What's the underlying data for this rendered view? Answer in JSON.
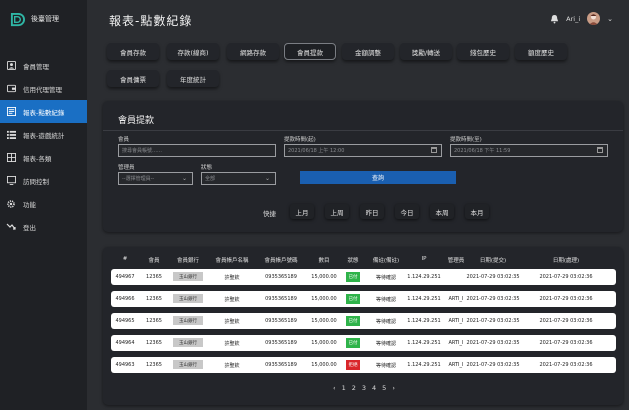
{
  "sidebar": {
    "brand": "後臺管理",
    "items": [
      {
        "label": "會員管理",
        "icon": "person-icon",
        "active": false
      },
      {
        "label": "信用代理管理",
        "icon": "wallet-icon",
        "active": false
      },
      {
        "label": "報表-點數紀錄",
        "icon": "report-icon",
        "active": true
      },
      {
        "label": "報表-遊戲統計",
        "icon": "list-icon",
        "active": false
      },
      {
        "label": "報表-各類",
        "icon": "grid-icon",
        "active": false
      },
      {
        "label": "訪問控制",
        "icon": "monitor-icon",
        "active": false
      },
      {
        "label": "功能",
        "icon": "gear-icon",
        "active": false
      },
      {
        "label": "登出",
        "icon": "logout-icon",
        "active": false
      }
    ]
  },
  "header": {
    "title": "報表-點數紀錄",
    "username": "Ari_i"
  },
  "tabs": [
    {
      "label": "會員存款",
      "active": false
    },
    {
      "label": "存款(線商)",
      "active": false
    },
    {
      "label": "網路存款",
      "active": false
    },
    {
      "label": "會員提款",
      "active": true
    },
    {
      "label": "金額調整",
      "active": false
    },
    {
      "label": "獎勵/轉送",
      "active": false
    },
    {
      "label": "錢包歷史",
      "active": false
    },
    {
      "label": "額度歷史",
      "active": false
    },
    {
      "label": "會員傭票",
      "active": false
    },
    {
      "label": "年度統計",
      "active": false
    }
  ],
  "filter": {
    "title": "會員提款",
    "member_label": "會員",
    "member_placeholder": "搜尋會員帳號……",
    "start_label": "提款時間(起)",
    "start_value": "2021/06/18 上午 12:00",
    "end_label": "提款時間(至)",
    "end_value": "2021/06/18 下午 11:59",
    "manager_label": "管理員",
    "manager_value": "--選擇管理員--",
    "status_label": "狀態",
    "status_value": "全部",
    "query_button": "查詢",
    "quick_label": "快捷",
    "quick_buttons": [
      "上月",
      "上周",
      "昨日",
      "今日",
      "本周",
      "本月"
    ]
  },
  "table": {
    "columns": [
      "#",
      "會員",
      "會員銀行",
      "會員帳戶名稱",
      "會員帳戶號碼",
      "數目",
      "狀態",
      "備註(備註)",
      "IP",
      "管理員",
      "日期(提交)",
      "日期(處理)"
    ],
    "rows": [
      {
        "id": "494967",
        "member": "12365",
        "bank": "玉山銀行",
        "acct_name": "許聖欽",
        "acct_no": "0935365189",
        "amount": "15,000.00",
        "status": "已付",
        "status_color": "#2fb34a",
        "note": "等待確認",
        "ip": "1.124.29.251",
        "admin": "",
        "submit": "2021-07-29 03:02:35",
        "process": "2021-07-29 03:02:36"
      },
      {
        "id": "494966",
        "member": "12365",
        "bank": "玉山銀行",
        "acct_name": "許聖欽",
        "acct_no": "0935365189",
        "amount": "15,000.00",
        "status": "已付",
        "status_color": "#2fb34a",
        "note": "等待確認",
        "ip": "1.124.29.251",
        "admin": "ARTI_I",
        "submit": "2021-07-29 03:02:35",
        "process": "2021-07-29 03:02:36"
      },
      {
        "id": "494965",
        "member": "12365",
        "bank": "玉山銀行",
        "acct_name": "許聖欽",
        "acct_no": "0935365189",
        "amount": "15,000.00",
        "status": "已付",
        "status_color": "#2fb34a",
        "note": "等待確認",
        "ip": "1.124.29.251",
        "admin": "ARTI_I",
        "submit": "2021-07-29 03:02:35",
        "process": "2021-07-29 03:02:36"
      },
      {
        "id": "494964",
        "member": "12365",
        "bank": "玉山銀行",
        "acct_name": "許聖欽",
        "acct_no": "0935365189",
        "amount": "15,000.00",
        "status": "已付",
        "status_color": "#2fb34a",
        "note": "等待確認",
        "ip": "1.124.29.251",
        "admin": "ARTI_I",
        "submit": "2021-07-29 03:02:35",
        "process": "2021-07-29 03:02:36"
      },
      {
        "id": "494963",
        "member": "12365",
        "bank": "玉山銀行",
        "acct_name": "許聖欽",
        "acct_no": "0935365189",
        "amount": "15,000.00",
        "status": "拒絕",
        "status_color": "#d9262b",
        "note": "等待確認",
        "ip": "1.124.29.251",
        "admin": "ARTI_I",
        "submit": "2021-07-29 03:02:35",
        "process": "2021-07-29 03:02:36"
      }
    ]
  },
  "pager": {
    "prev": "‹",
    "pages": [
      "1",
      "2",
      "3",
      "4",
      "5"
    ],
    "next": "›"
  },
  "colors": {
    "accent": "#1a6fc4",
    "paid": "#2fb34a",
    "rejected": "#d9262b"
  }
}
